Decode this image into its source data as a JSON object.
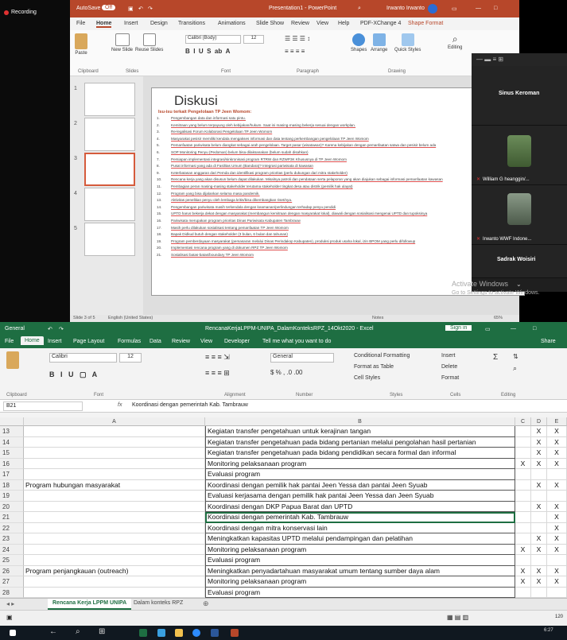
{
  "recording": {
    "label": "Recording"
  },
  "ppt": {
    "autosave": "AutoSave",
    "autosave_state": "Off",
    "title": "Presentation1 - PowerPoint",
    "user": "Irwanto Irwanto",
    "tabs": [
      "File",
      "Home",
      "Insert",
      "Design",
      "Transitions",
      "Animations",
      "Slide Show",
      "Review",
      "View",
      "Help",
      "PDF-XChange 4",
      "Shape Format"
    ],
    "ribbon": {
      "paste": "Paste",
      "new_slide": "New Slide",
      "reuse_slides": "Reuse Slides",
      "font_name": "Calibri (Body)",
      "font_size": "12",
      "shapes": "Shapes",
      "arrange": "Arrange",
      "quick_styles": "Quick Styles",
      "editing": "Editing",
      "groups": [
        "Clipboard",
        "Slides",
        "Font",
        "Paragraph",
        "Drawing"
      ]
    },
    "thumb_numbers": [
      "1",
      "2",
      "3",
      "4",
      "5"
    ],
    "slide": {
      "title": "Diskusi",
      "subtitle": "Isu-isu terkait Pengelolaan TP Jeen Womom:",
      "items": [
        {
          "n": "1.",
          "t": "Pengembangan data dan informasi satu pintu."
        },
        {
          "n": "2.",
          "t": "Kemitraan yang belum terpayung oleh kebijakan/hukum. Saat ini masing-masing bekerja sesuai dengan workplan."
        },
        {
          "n": "3.",
          "t": "Re-legalisasi Forum Kolaborasi Pengelolaan TP Jeen Womom"
        },
        {
          "n": "4.",
          "t": "Masyarakat pesisir memiliki kendala mengakses informasi dan data tentang perkembangan pengelolaan TP Jeen Womom"
        },
        {
          "n": "5.",
          "t": "Pemanfaatan pariwisata belum diangkat sebagai arah pengelolaan. Target pasar (wisatawan)? Karena kebijakan dengan pemanfaatan satwa dan pesisir belum ada"
        },
        {
          "n": "6.",
          "t": "SOP Monitoring Penyu (Pedoman) belum bisa dilaksanakan (belum sudah disahkan)"
        },
        {
          "n": "7.",
          "t": "Persiapan implementasi integrasi/sinkronisasi program RTRW dan RZWP3K Khususnya di TP Jeen Womom"
        },
        {
          "n": "8.",
          "t": "Pusat informasi yang ada di Fasilitas Umum (Bandara)? Integrasi pariwisata di kawasan"
        },
        {
          "n": "9.",
          "t": "Keterbatasan anggaran dari Pemda dan identifikasi program prioritas (perlu dukungan dari mitra stakeholder)"
        },
        {
          "n": "10.",
          "t": "Rencana kerja yang akan disusun belum dapat dilakukan. Misalnya patroli dan pendataan serta pelaporan yang akan diajukan sebagai informasi pemanfaatan kawasan"
        },
        {
          "n": "11.",
          "t": "Pembagian peran masing-masing stakeholder terutama stakeholder tingkat desa atau distrik (pemilik hak ulayat)"
        },
        {
          "n": "12.",
          "t": "Program yang bisa dijalankan selama masa pandemik."
        },
        {
          "n": "13.",
          "t": "Aktivitas penelitian penyu oleh lembaga kritis/bisa dikembangkan riset/nya."
        },
        {
          "n": "14.",
          "t": "Pengembangan pariwisata masih terkendala dengan keamanan/perlindungan terhadap penyu pendidi"
        },
        {
          "n": "15.",
          "t": "UPTD harus bekerja dekat dengan masyarakat (membangun kemitraan dengan masyarakat lokal), diawali dengan sosialisasi mengenai UPTD dan tupoksinya"
        },
        {
          "n": "16.",
          "t": "Pariwisata merupakan program prioritas Dinas Pariwisata Kabupaten Tambrauw"
        },
        {
          "n": "17.",
          "t": "Masih perlu dilakukan sosialisasi tentang pemanfaatan TP Jeen Womom"
        },
        {
          "n": "18.",
          "t": "Bapak Didkud butuh dengan stakeholder (3 bulan, 6 bulan dan tahunan)"
        },
        {
          "n": "19.",
          "t": "Program pemberdayaan masyarakat (pemasaran melalui Dinas Perindakop Kabupaten), produksi produk usaha lokal, izin BPOM yang perlu difollowup"
        },
        {
          "n": "20.",
          "t": "Implementasi rencana program yang di dokumen RPZ TP Jeen Womom"
        },
        {
          "n": "21.",
          "t": "Sosialisasi batas-batas/boundary TP Jeen Womom"
        }
      ]
    },
    "status": {
      "slide_of": "Slide 3 of 5",
      "language": "English (United States)",
      "notes": "Notes",
      "zoom": "65%"
    }
  },
  "zoom_panel": {
    "tiles": [
      {
        "name": "Sinus Keroman",
        "sub": ""
      },
      {
        "name": "",
        "sub": "William G heanggin/..."
      },
      {
        "name": "",
        "sub": "Irwanto WWF Indone..."
      },
      {
        "name": "Sadrak Woisiri",
        "sub": ""
      }
    ]
  },
  "activate": {
    "line1": "Activate Windows",
    "line2": "Go to Settings to activate Windows."
  },
  "excel": {
    "title": "RencanaKerjaLPPM-UNIPA_DalamKonteksRPZ_14Okt2020 - Excel",
    "sign_in": "Sign in",
    "share": "Share",
    "tabs": [
      "File",
      "Home",
      "Insert",
      "Page Layout",
      "Formulas",
      "Data",
      "Review",
      "View",
      "Developer",
      "Tell me what you want to do"
    ],
    "ribbon": {
      "font": "Calibri",
      "size": "12",
      "number_format": "General",
      "conditional": "Conditional Formatting",
      "format_table": "Format as Table",
      "cell_styles": "Cell Styles",
      "insert": "Insert",
      "delete": "Delete",
      "format": "Format",
      "groups": [
        "Clipboard",
        "Font",
        "Alignment",
        "Number",
        "Styles",
        "Cells",
        "Editing"
      ]
    },
    "name_box": "B21",
    "formula": "Koordinasi dengan pemerintah Kab. Tambrauw",
    "columns": [
      "A",
      "B",
      "C",
      "D",
      "E"
    ],
    "rows": [
      {
        "n": "13",
        "a": "",
        "b": "Kegiatan transfer pengetahuan untuk kerajinan tangan",
        "c": "",
        "d": "X",
        "e": "X"
      },
      {
        "n": "14",
        "a": "",
        "b": "Kegiatan transfer pengetahuan pada bidang pertanian melalui pengolahan hasil pertanian",
        "c": "",
        "d": "X",
        "e": "X"
      },
      {
        "n": "15",
        "a": "",
        "b": "Kegiatan transfer pengetahuan pada bidang pendidikan secara formal dan informal",
        "c": "",
        "d": "X",
        "e": "X"
      },
      {
        "n": "16",
        "a": "",
        "b": "Monitoring pelaksanaan program",
        "c": "X",
        "d": "X",
        "e": "X"
      },
      {
        "n": "17",
        "a": "",
        "b": "Evaluasi program",
        "c": "",
        "d": "",
        "e": ""
      },
      {
        "n": "18",
        "a": "Program hubungan masyarakat",
        "b": "Koordinasi dengan pemilik hak pantai Jeen Yessa dan pantai Jeen Syuab",
        "c": "",
        "d": "X",
        "e": "X"
      },
      {
        "n": "19",
        "a": "",
        "b": "Evaluasi kerjasama dengan pemilik hak pantai Jeen Yessa dan Jeen Syuab",
        "c": "",
        "d": "",
        "e": ""
      },
      {
        "n": "20",
        "a": "",
        "b": "Koordinasi dengan DKP Papua Barat dan UPTD",
        "c": "",
        "d": "X",
        "e": "X"
      },
      {
        "n": "21",
        "a": "",
        "b": "Koordinasi dengan pemerintah Kab. Tambrauw",
        "c": "",
        "d": "",
        "e": "X"
      },
      {
        "n": "22",
        "a": "",
        "b": "Koordinasi dengan mitra konservasi lain",
        "c": "",
        "d": "",
        "e": "X"
      },
      {
        "n": "23",
        "a": "",
        "b": "Meningkatkan kapasitas UPTD melalui pendampingan dan pelatihan",
        "c": "",
        "d": "X",
        "e": "X"
      },
      {
        "n": "24",
        "a": "",
        "b": "Monitoring pelaksanaan program",
        "c": "X",
        "d": "X",
        "e": "X"
      },
      {
        "n": "25",
        "a": "",
        "b": "Evaluasi program",
        "c": "",
        "d": "",
        "e": ""
      },
      {
        "n": "26",
        "a": "Program penjangkauan (outreach)",
        "b": "Meningkatkan penyadartahuan masyarakat umum tentang sumber daya alam",
        "c": "X",
        "d": "X",
        "e": "X"
      },
      {
        "n": "27",
        "a": "",
        "b": "Monitoring pelaksanaan program",
        "c": "X",
        "d": "X",
        "e": "X"
      },
      {
        "n": "28",
        "a": "",
        "b": "Evaluasi program",
        "c": "",
        "d": "",
        "e": ""
      }
    ],
    "sheets": [
      "Rencana Kerja LPPM UNIPA",
      "Dalam konteks RPZ"
    ],
    "zoom": "120"
  },
  "taskbar": {
    "time": "6:27"
  }
}
